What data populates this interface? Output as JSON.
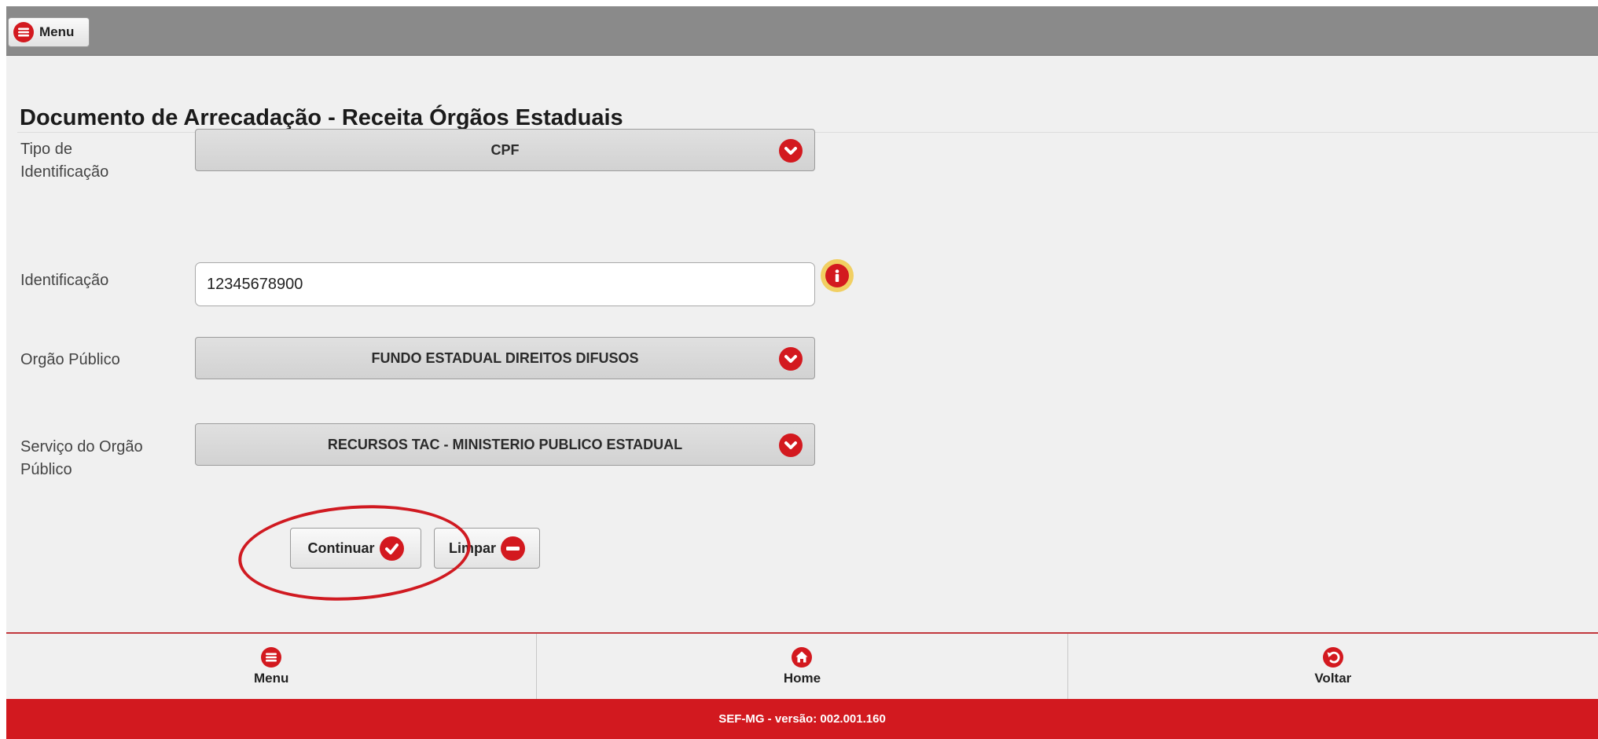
{
  "header": {
    "menu_label": "Menu"
  },
  "page_title": "Documento de Arrecadação - Receita Órgãos Estaduais",
  "form": {
    "tipo_identificacao": {
      "label_line1": "Tipo de",
      "label_line2": "Identificação",
      "value": "CPF"
    },
    "identificacao": {
      "label": "Identificação",
      "value": "12345678900"
    },
    "orgao_publico": {
      "label": "Orgão Público",
      "value": "FUNDO ESTADUAL DIREITOS DIFUSOS"
    },
    "servico_orgao": {
      "label_line1": "Serviço do Orgão",
      "label_line2": "Público",
      "value": "RECURSOS TAC - MINISTERIO PUBLICO ESTADUAL"
    }
  },
  "actions": {
    "continuar_label": "Continuar",
    "limpar_label": "Limpar"
  },
  "footer_nav": {
    "menu_label": "Menu",
    "home_label": "Home",
    "voltar_label": "Voltar"
  },
  "footer": {
    "version_text": "SEF-MG - versão: 002.001.160"
  },
  "colors": {
    "accent": "#d3191f",
    "topbar": "#8a8a8a",
    "background": "#f0f0f0",
    "info_badge": "#f1cf62"
  }
}
